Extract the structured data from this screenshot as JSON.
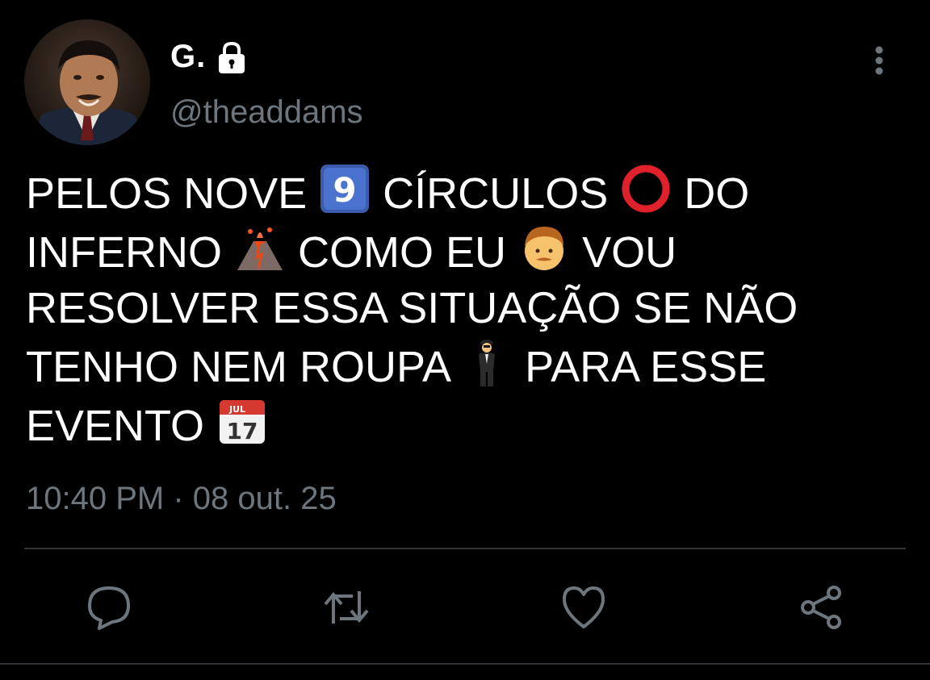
{
  "author": {
    "display_name": "G.",
    "handle": "@theaddams",
    "avatar_icon": "profile-photo",
    "lock_icon": "lock-icon"
  },
  "tweet": {
    "segments": [
      "PELOS NOVE",
      "CÍRCULOS",
      "DO",
      "INFERNO",
      "COMO EU",
      "VOU",
      "RESOLVER ESSA SITUAÇÃO SE NÃO",
      "TENHO NEM ROUPA",
      "PARA ESSE",
      "EVENTO"
    ],
    "emojis": {
      "nine": "9",
      "calendar_month": "JUL",
      "calendar_day": "17"
    },
    "timestamp": "10:40 PM · 08 out. 25"
  },
  "actions": [
    "reply-icon",
    "retweet-icon",
    "like-icon",
    "share-icon"
  ],
  "colors": {
    "background": "#000000",
    "text": "#ffffff",
    "secondary": "#6e767d",
    "divider": "#2f3336"
  }
}
